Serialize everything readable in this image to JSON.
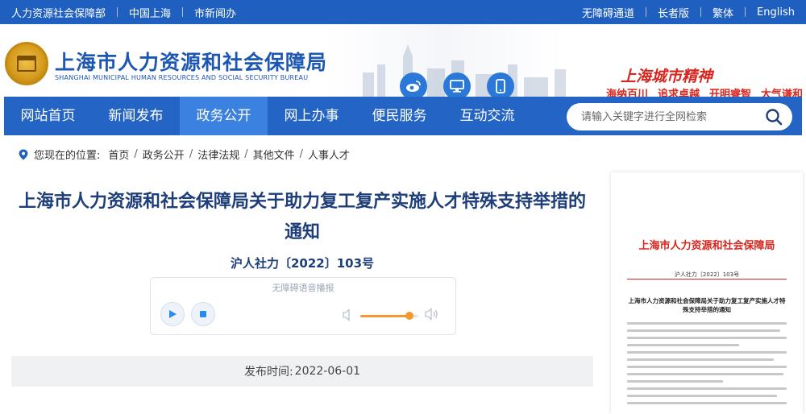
{
  "topbar": {
    "left_links": [
      "人力资源社会保障部",
      "中国上海",
      "市新闻办"
    ],
    "right_links": [
      "无障碍通道",
      "长者版",
      "繁体",
      "English"
    ]
  },
  "header": {
    "title_cn": "上海市人力资源和社会保障局",
    "title_en": "SHANGHAI MUNICIPAL HUMAN RESOURCES AND SOCIAL SECURITY BUREAU",
    "social_icons": [
      "weibo-icon",
      "monitor-icon",
      "mobile-icon"
    ],
    "spirit_title": "上海城市精神",
    "spirit_items": [
      "海纳百川",
      "追求卓越",
      "开明睿智",
      "大气谦和"
    ]
  },
  "nav": {
    "items": [
      "网站首页",
      "新闻发布",
      "政务公开",
      "网上办事",
      "便民服务",
      "互动交流"
    ],
    "active_index": 2,
    "search_placeholder": "请输入关键字进行全网检索"
  },
  "breadcrumb": {
    "label": "您现在的位置:",
    "items": [
      "首页",
      "政务公开",
      "法律法规",
      "其他文件",
      "人事人才"
    ]
  },
  "article": {
    "title": "上海市人力资源和社会保障局关于助力复工复产实施人才特殊支持举措的通知",
    "doc_number": "沪人社力〔2022〕103号",
    "player_label": "无障碍语音播报",
    "volume_level": 0.85,
    "publish_label": "发布时间:",
    "publish_date": "2022-06-01"
  },
  "doc_preview": {
    "header": "上海市人力资源和社会保障局",
    "doc_number": "沪人社力〔2022〕103号",
    "title": "上海市人力资源和社会保障局关于助力复工复产实施人才特殊支持举措的通知"
  },
  "colors": {
    "brand_blue": "#1f5fbf",
    "nav_active": "#3b82e0",
    "accent_red": "#d8261e",
    "volume_orange": "#f39a2e"
  }
}
